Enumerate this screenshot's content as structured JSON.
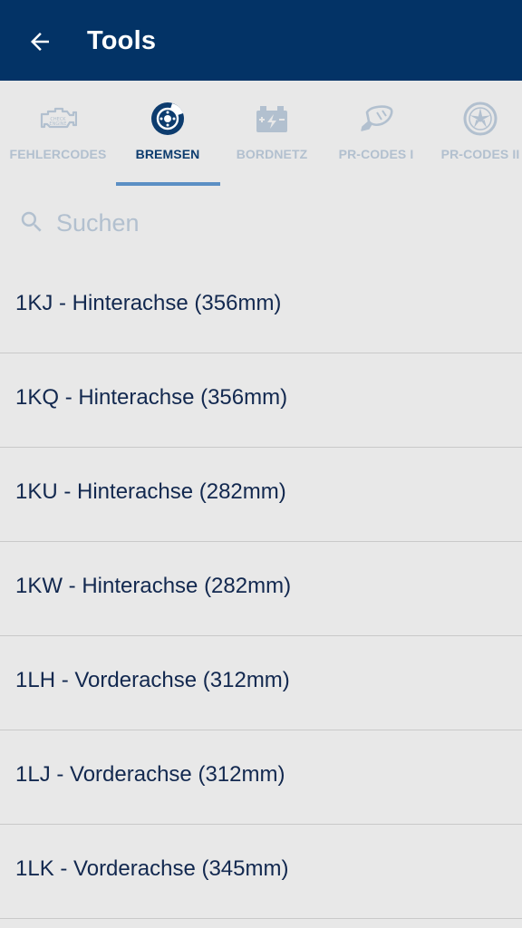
{
  "appbar": {
    "title": "Tools",
    "back_icon": "arrow-left-icon"
  },
  "tabs": [
    {
      "label": "FEHLERCODES",
      "icon": "engine-check-icon",
      "active": false
    },
    {
      "label": "BREMSEN",
      "icon": "brake-disc-icon",
      "active": true
    },
    {
      "label": "BORDNETZ",
      "icon": "battery-icon",
      "active": false
    },
    {
      "label": "PR-CODES I",
      "icon": "mirror-icon",
      "active": false
    },
    {
      "label": "PR-CODES II",
      "icon": "wheel-rim-icon",
      "active": false
    }
  ],
  "search": {
    "placeholder": "Suchen",
    "value": ""
  },
  "list": {
    "items": [
      {
        "label": "1KJ - Hinterachse (356mm)"
      },
      {
        "label": "1KQ - Hinterachse (356mm)"
      },
      {
        "label": "1KU - Hinterachse (282mm)"
      },
      {
        "label": "1KW - Hinterachse (282mm)"
      },
      {
        "label": "1LH - Vorderachse (312mm)"
      },
      {
        "label": "1LJ - Vorderachse (312mm)"
      },
      {
        "label": "1LK - Vorderachse (345mm)"
      }
    ]
  },
  "colors": {
    "appbar": "#033366",
    "active_tab": "#0d3c6e",
    "inactive_tab": "#b2c0cf",
    "indicator": "#5b8fc4",
    "background": "#e8e8e8"
  }
}
